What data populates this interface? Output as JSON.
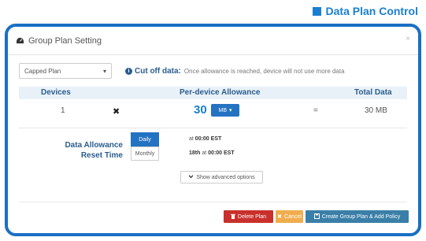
{
  "header_label": "Data Plan Control",
  "dialog": {
    "title": "Group Plan Setting",
    "close": "×"
  },
  "plan_select": {
    "value": "Capped Plan",
    "arrow": "▾"
  },
  "cutoff": {
    "title": "Cut off data:",
    "description": "Once allowance is reached, device will not use more data"
  },
  "table": {
    "headers": {
      "devices": "Devices",
      "allowance": "Per-device Allowance",
      "total": "Total Data"
    },
    "row": {
      "devices": "1",
      "times": "✖",
      "allowance_value": "30",
      "unit": "MB",
      "equals": "=",
      "total": "30 MB"
    }
  },
  "reset": {
    "label_line1": "Data Allowance",
    "label_line2": "Reset Time",
    "options": [
      {
        "label": "Daily",
        "at_prefix": "at",
        "time": "00:00 EST",
        "active": true
      },
      {
        "label": "Monthly",
        "day": "18th",
        "at_prefix": "at",
        "time": "00:00 EST",
        "active": false
      }
    ]
  },
  "advanced": {
    "label": "Show advanced options"
  },
  "footer": {
    "delete": "Delete Plan",
    "cancel": "Cancel",
    "create": "Create Group Plan & Add Policy"
  },
  "colors": {
    "accent": "#1a7fd0",
    "frame": "#1a6fc4",
    "danger": "#c9302c",
    "warning": "#f0ad4e",
    "primary": "#3a7fa7"
  },
  "icons": {
    "dialog": "dashboard-icon",
    "info": "info-circle-icon",
    "advanced": "chevron-down-icon",
    "delete": "trash-icon",
    "cancel": "x-icon",
    "create": "save-icon"
  }
}
